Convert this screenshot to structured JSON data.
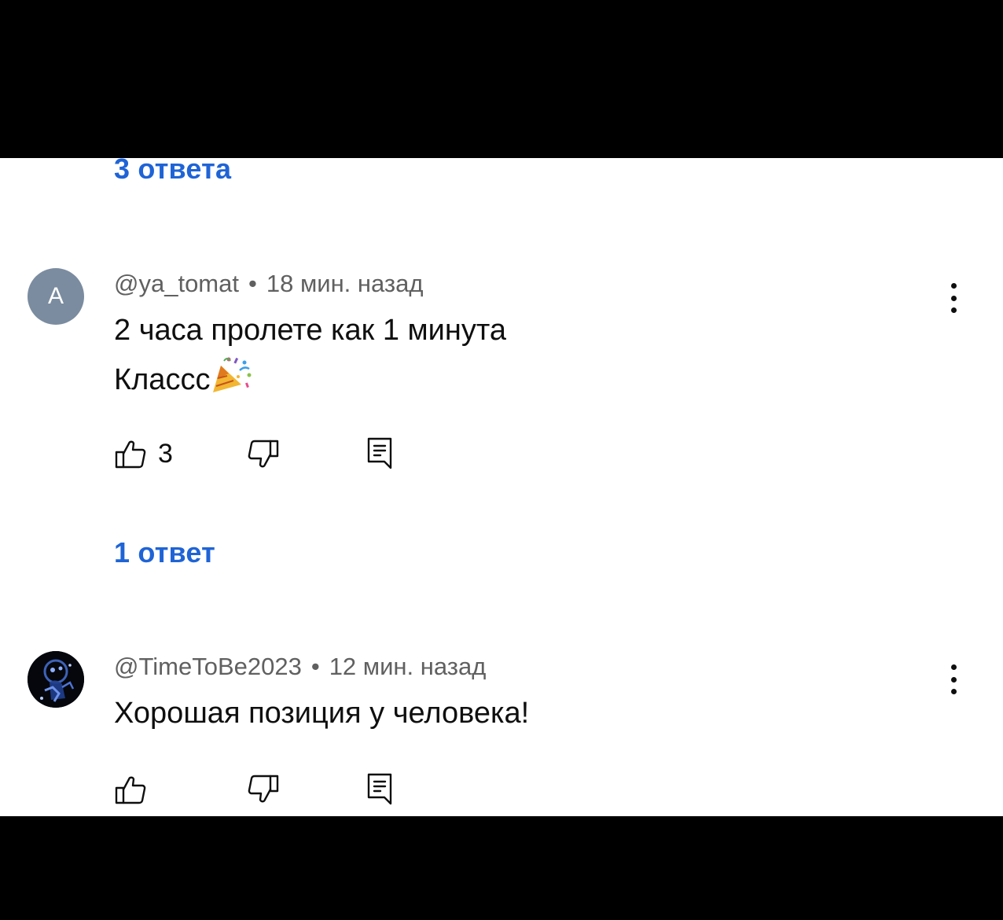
{
  "thread1": {
    "replies_label": "3 ответа"
  },
  "comment1": {
    "avatar_letter": "A",
    "author": "@ya_tomat",
    "separator": "•",
    "time": "18 мин. назад",
    "line1": "2 часа пролете как 1 минута",
    "line2": "Классс",
    "emoji": "party-popper-icon",
    "likes": "3",
    "replies_label": "1 ответ"
  },
  "comment2": {
    "author": "@TimeToBe2023",
    "separator": "•",
    "time": "12 мин. назад",
    "text": "Хорошая позиция у человека!"
  },
  "colors": {
    "link": "#1f64d6",
    "meta": "#606060",
    "text": "#0f0f0f",
    "avatar_bg": "#7b8ca0"
  }
}
